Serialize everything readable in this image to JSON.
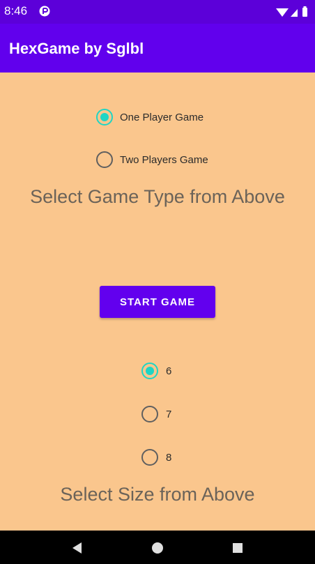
{
  "status_bar": {
    "time": "8:46",
    "icons": [
      "app-notification-icon",
      "wifi-icon",
      "signal-icon",
      "battery-icon"
    ]
  },
  "app_bar": {
    "title": "HexGame by Sglbl"
  },
  "game_type": {
    "options": [
      {
        "label": "One Player Game",
        "checked": true
      },
      {
        "label": "Two Players Game",
        "checked": false
      }
    ],
    "heading": "Select Game Type from Above"
  },
  "start_button": {
    "label": "START GAME"
  },
  "board_size": {
    "options": [
      {
        "label": "6",
        "checked": true
      },
      {
        "label": "7",
        "checked": false
      },
      {
        "label": "8",
        "checked": false
      }
    ],
    "heading": "Select Size from Above"
  },
  "nav_bar": {
    "icons": [
      "back-icon",
      "home-icon",
      "recents-icon"
    ]
  },
  "colors": {
    "background": "#FAC68D",
    "status_bar": "#5C00D9",
    "app_bar": "#6100ED",
    "accent": "#1FD5C4",
    "button": "#6200EE"
  }
}
